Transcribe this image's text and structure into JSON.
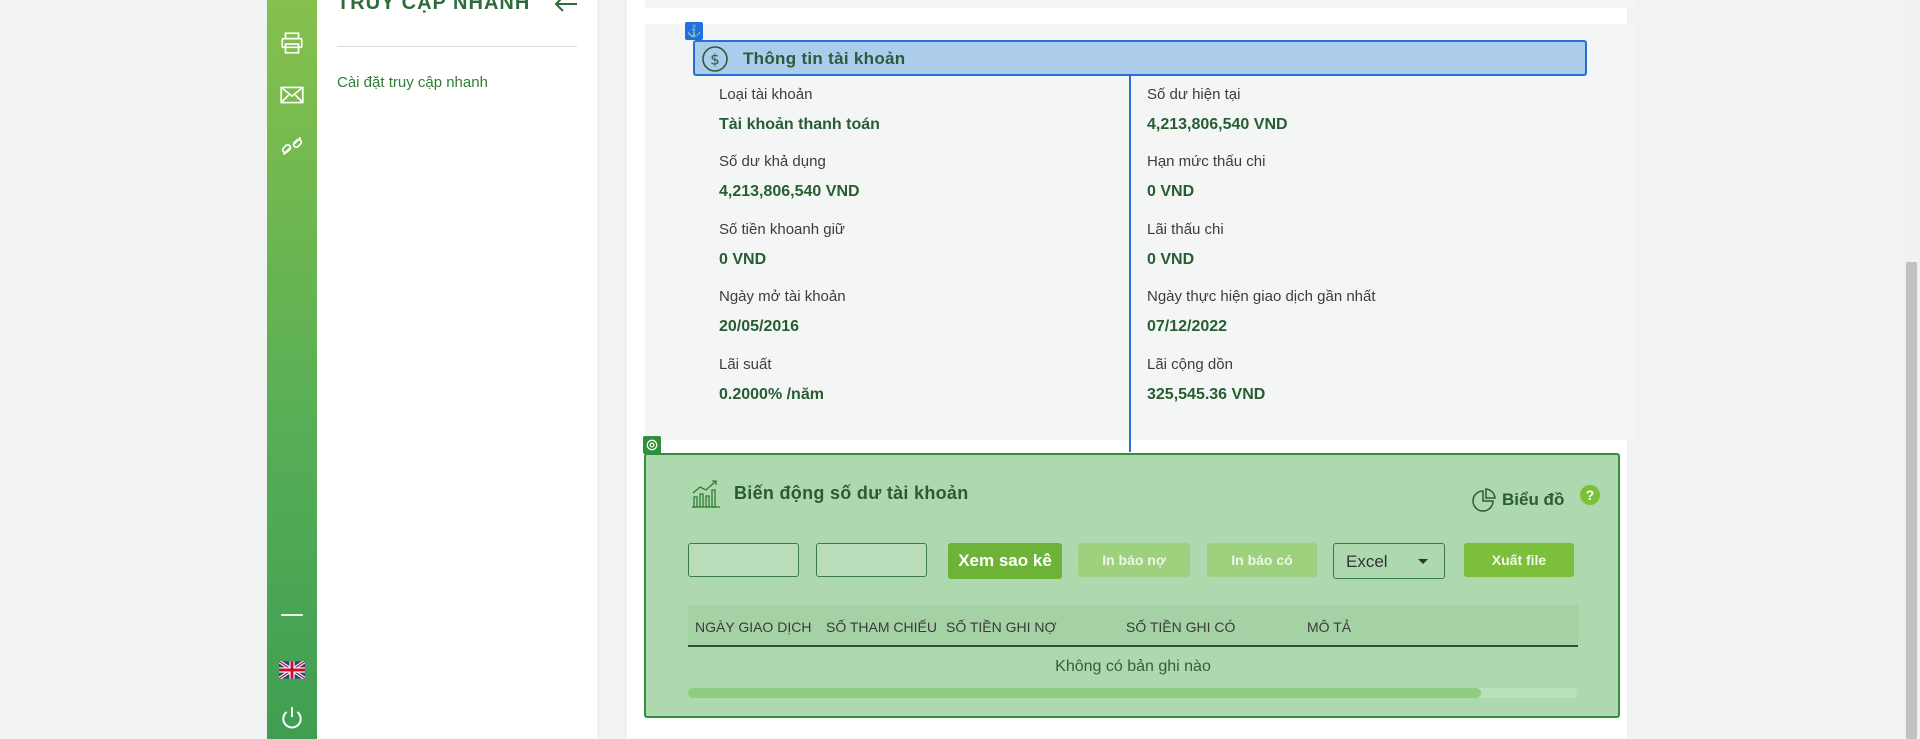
{
  "sidebar": {
    "icons": [
      "grid-icon",
      "printer-icon",
      "mail-icon",
      "link-icon",
      "minus-icon",
      "uk-flag-icon",
      "power-icon"
    ]
  },
  "quick_access": {
    "title": "TRUY CẬP NHANH",
    "settings_link": "Cài đặt truy cập nhanh"
  },
  "account_info": {
    "title": "Thông tin tài khoản",
    "left_fields": [
      {
        "label": "Loại tài khoản",
        "value": "Tài khoản thanh toán"
      },
      {
        "label": "Số dư khả dụng",
        "value": "4,213,806,540 VND"
      },
      {
        "label": "Số tiền khoanh giữ",
        "value": "0 VND"
      },
      {
        "label": "Ngày mở tài khoản",
        "value": "20/05/2016"
      },
      {
        "label": "Lãi suất",
        "value": "0.2000% /năm"
      }
    ],
    "right_fields": [
      {
        "label": "Số dư hiện tại",
        "value": "4,213,806,540 VND"
      },
      {
        "label": "Hạn mức thấu chi",
        "value": "0 VND"
      },
      {
        "label": "Lãi thấu chi",
        "value": "0 VND"
      },
      {
        "label": "Ngày thực hiện giao dịch gần nhất",
        "value": "07/12/2022"
      },
      {
        "label": "Lãi cộng dồn",
        "value": "325,545.36 VND"
      }
    ]
  },
  "balance_movement": {
    "title": "Biến động số dư tài khoản",
    "chart_link": "Biểu đồ",
    "help": "?",
    "from_date": "",
    "to_date": "",
    "view_statement_button": "Xem sao kê",
    "print_debit_button": "In báo nợ",
    "print_credit_button": "In báo có",
    "export_format": "Excel",
    "export_button": "Xuất file",
    "columns": [
      "NGÀY GIAO DỊCH",
      "SỐ THAM CHIẾU",
      "SỐ TIỀN GHI NỢ",
      "SỐ TIỀN GHI CÓ",
      "MÔ TẢ"
    ],
    "empty_message": "Không có bản ghi nào"
  },
  "colors": {
    "brand_green": "#56ad56",
    "highlight_blue": "#2a6fd4",
    "panel_green": "#aed9af"
  }
}
